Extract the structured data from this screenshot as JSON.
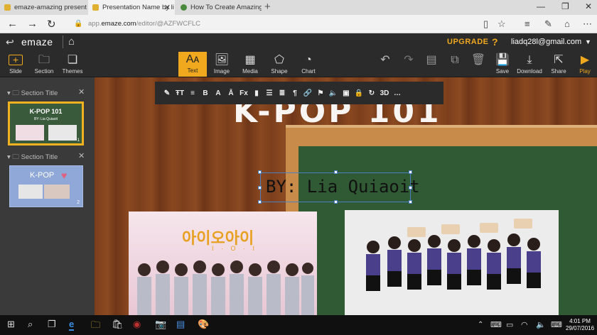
{
  "browser": {
    "tabs": [
      {
        "label": "emaze-amazing presentation",
        "favicon_color": "#e0b030"
      },
      {
        "label": "Presentation Name by li",
        "favicon_color": "#e0b030"
      },
      {
        "label": "How To Create Amazing Pres",
        "favicon_color": "#4a8a3c"
      }
    ],
    "new_tab": "+",
    "window_controls": [
      "—",
      "❐",
      "✕"
    ],
    "url_prefix": "app.",
    "url_domain": "emaze.com",
    "url_path": "/editor/@AZFWCFLC",
    "icons": [
      "back-icon",
      "forward-icon",
      "refresh-icon",
      "lock-icon",
      "reading-view-icon",
      "favorite-icon",
      "hub-icon",
      "web-note-icon",
      "share-icon",
      "more-icon"
    ]
  },
  "header": {
    "logo": "emaze",
    "upgrade": "UPGRADE",
    "help": "?",
    "email": "liadq28l@gmail.com"
  },
  "toolbar": {
    "left": [
      {
        "label": "Slide",
        "glyph": "+"
      },
      {
        "label": "Section",
        "glyph": "🗀"
      },
      {
        "label": "Themes",
        "glyph": "❏"
      }
    ],
    "center": [
      {
        "label": "Text",
        "glyph": "Aᴀ"
      },
      {
        "label": "Image",
        "glyph": "🖼"
      },
      {
        "label": "Media",
        "glyph": "▦"
      },
      {
        "label": "Shape",
        "glyph": "⬠"
      },
      {
        "label": "Chart",
        "glyph": "◔"
      }
    ],
    "right": [
      {
        "label": "",
        "glyph": "↶"
      },
      {
        "label": "",
        "glyph": "↷"
      },
      {
        "label": "",
        "glyph": "▤"
      },
      {
        "label": "",
        "glyph": "⧉"
      },
      {
        "label": "",
        "glyph": "🗑"
      },
      {
        "label": "Save",
        "glyph": "💾"
      },
      {
        "label": "Download",
        "glyph": "⤓"
      },
      {
        "label": "Share",
        "glyph": "⇱"
      },
      {
        "label": "Play",
        "glyph": "▶"
      }
    ]
  },
  "sidebar": {
    "sections": [
      {
        "title": "Section Title",
        "slide_title": "K-POP 101",
        "slide_sub": "BY: Lia Quiaoit",
        "slide_num": "1"
      },
      {
        "title": "Section Title",
        "slide_title": "K-POP",
        "slide_num": "2"
      }
    ]
  },
  "slide": {
    "title": "K-POP 101",
    "byline": "BY: Lia Quiaoit",
    "photo1_logo": "아이오아이",
    "photo1_sub": "I · O · I"
  },
  "format_toolbar": [
    "✎",
    "ŦT",
    "≡",
    "B",
    "A",
    "Ā",
    "Fx",
    "▮",
    "☰",
    "≣",
    "¶",
    "🔗",
    "⚑",
    "🔈",
    "▣",
    "🔒",
    "↻",
    "3D",
    "…"
  ],
  "taskbar": {
    "time": "4:01 PM",
    "date": "29/07/2016"
  },
  "colors": {
    "accent": "#f0a81e",
    "dark": "#2b2b2b",
    "board": "#2f5a34"
  }
}
